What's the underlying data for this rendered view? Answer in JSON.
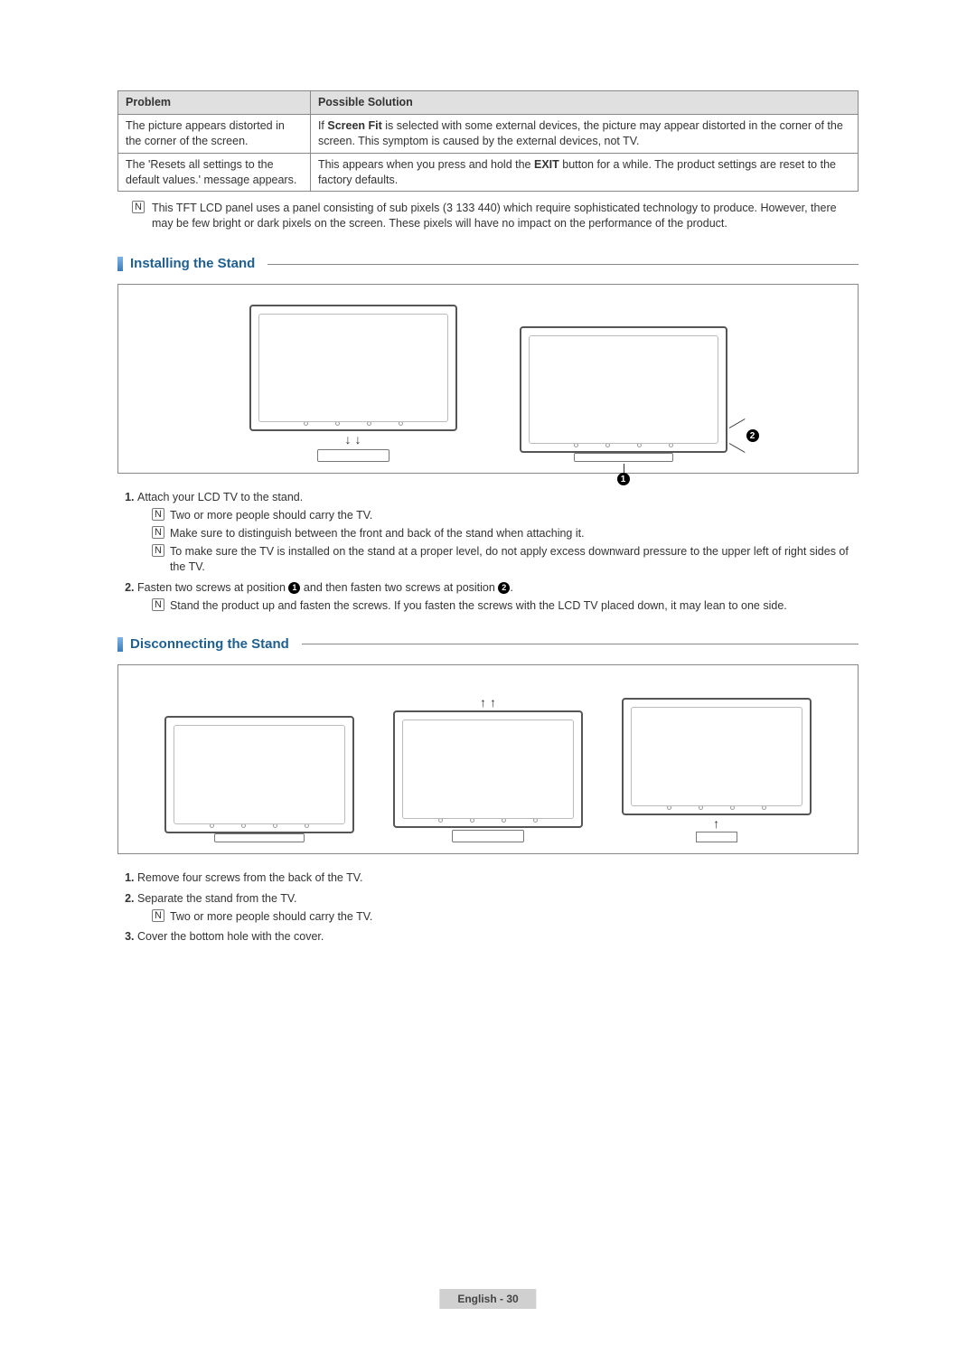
{
  "table": {
    "header_problem": "Problem",
    "header_solution": "Possible Solution",
    "row1_problem": "The picture appears distorted in the corner of the screen.",
    "row1_solution_a": "If ",
    "row1_solution_bold": "Screen Fit",
    "row1_solution_b": " is selected with some external devices, the picture may appear distorted in the corner of the screen. This symptom is caused by the external devices, not TV.",
    "row2_problem": "The 'Resets all settings to the default values.' message appears.",
    "row2_solution_a": "This appears when you press and hold the ",
    "row2_solution_bold": "EXIT",
    "row2_solution_b": " button for a while. The product settings are reset to the factory defaults."
  },
  "panel_note": "This TFT LCD panel uses a panel consisting of sub pixels (3 133 440) which require sophisticated technology to produce. However, there may be few bright or dark pixels on the screen. These pixels will have no impact on the performance of the product.",
  "install": {
    "title": "Installing the Stand",
    "step1": "Attach your LCD TV to the stand.",
    "step1_n1": "Two or more people should carry the TV.",
    "step1_n2": "Make sure to distinguish between the front and back of the stand when attaching it.",
    "step1_n3": "To make sure the TV is installed on the stand at a proper level, do not apply excess downward pressure to the upper left of right sides of the TV.",
    "step2_a": "Fasten two screws at position ",
    "step2_b": " and then fasten two screws at position ",
    "step2_c": ".",
    "step2_n1": "Stand the product up and fasten the screws. If you fasten the screws with the LCD TV placed down, it may lean to one side."
  },
  "disconnect": {
    "title": "Disconnecting the Stand",
    "step1": "Remove four screws from the back of the TV.",
    "step2": "Separate the stand from the TV.",
    "step2_n1": "Two or more people should carry the TV.",
    "step3": "Cover the bottom hole with the cover."
  },
  "footer": "English - 30",
  "icon_label": "N",
  "callout1": "1",
  "callout2": "2"
}
